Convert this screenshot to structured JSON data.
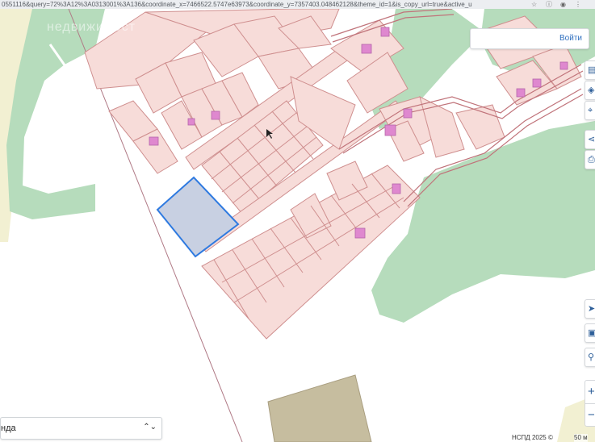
{
  "browser": {
    "url": "0551116&query=72%3A12%3A0313001%3A136&coordinate_x=7466522.5747e63973&coordinate_y=7357403.048462128&theme_id=1&is_copy_url=true&active_u",
    "icons": [
      "star-icon",
      "info-icon",
      "account-icon",
      "menu-icon"
    ]
  },
  "map": {
    "watermark": "недвижимост",
    "colors": {
      "parcel_fill": "#f7dcd9",
      "parcel_stroke": "#cf8f8f",
      "building_fill": "#df88cf",
      "forest": "#b6dcbc",
      "meadow": "#f2f0d2",
      "selected_fill": "#c8d0e2",
      "selected_stroke": "#2f7ae0",
      "road": "#c0737a",
      "brown_area": "#c6bd9f"
    }
  },
  "header": {
    "login_label": "Войти"
  },
  "toolbar": {
    "tools": [
      {
        "name": "ruler-icon",
        "glyph": "▤"
      },
      {
        "name": "layers-icon",
        "glyph": "◈"
      },
      {
        "name": "locate-icon",
        "glyph": "⌖"
      },
      {
        "name": "share-icon",
        "glyph": "⋖"
      },
      {
        "name": "print-icon",
        "glyph": "⎙"
      },
      {
        "name": "navigate-icon",
        "glyph": "➤"
      },
      {
        "name": "screen-icon",
        "glyph": "▣"
      },
      {
        "name": "zoom-search-icon",
        "glyph": "⚲"
      }
    ],
    "zoom_in": "+",
    "zoom_out": "−"
  },
  "layer_selector": {
    "label": "нда",
    "arrow": "⌃⌄"
  },
  "footer": {
    "copyright": "НСПД 2025 ©",
    "scale": "50 м"
  }
}
